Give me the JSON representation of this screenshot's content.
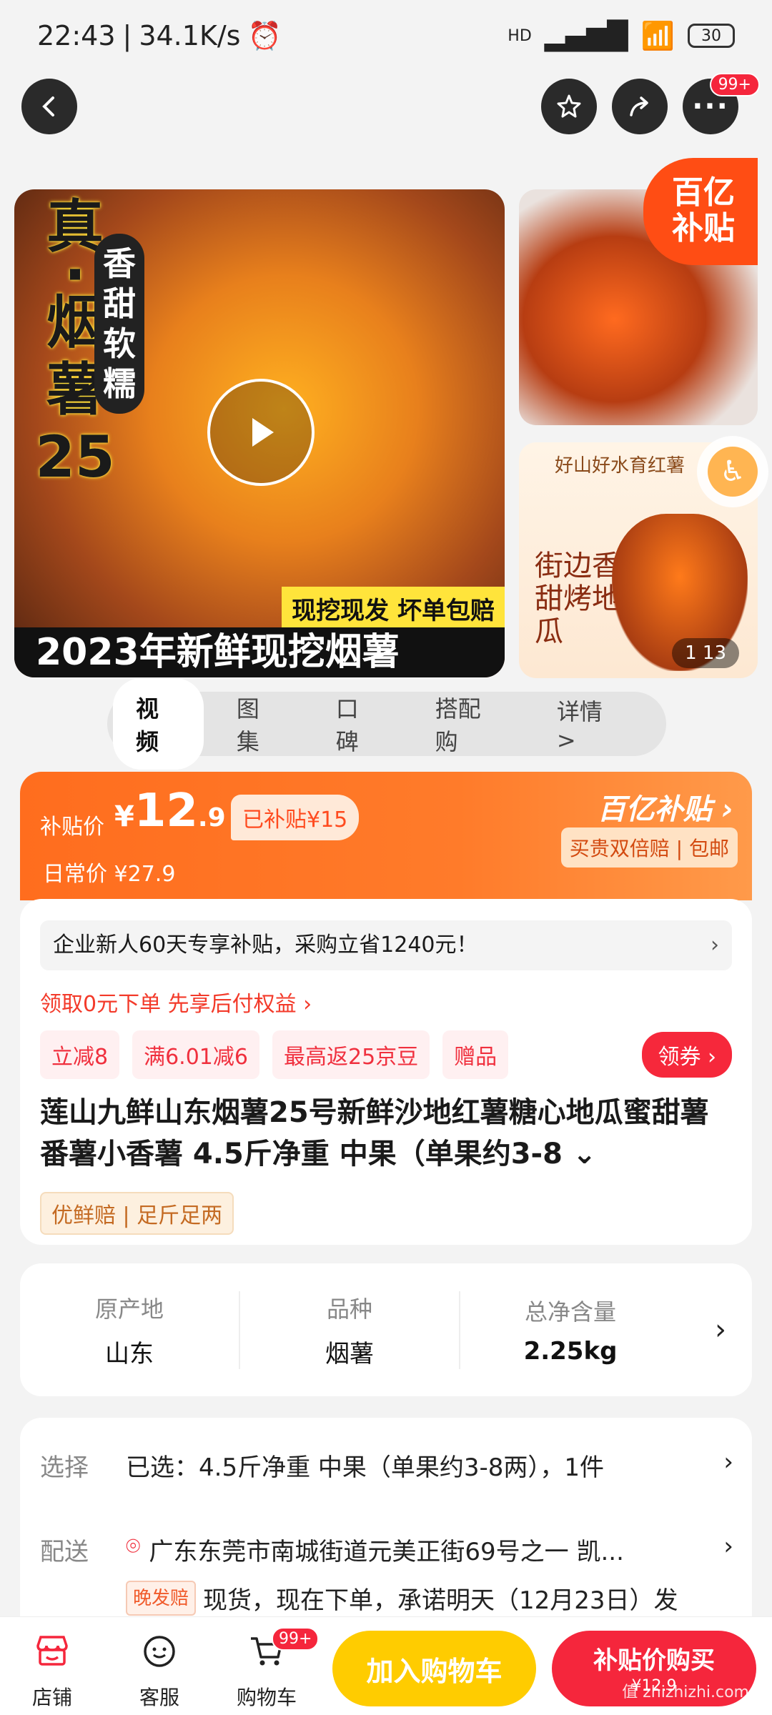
{
  "status": {
    "time": "22:43",
    "speed": "34.1K/s",
    "signal": "HD",
    "battery": "30"
  },
  "header": {
    "more_badge": "99+"
  },
  "gallery": {
    "main_vertical_title": [
      "真",
      "·",
      "烟",
      "薯",
      "25"
    ],
    "main_tag": [
      "香",
      "甜",
      "软",
      "糯"
    ],
    "main_promo": "现挖现发 坏单包赔",
    "main_caption": "2023年新鲜现挖烟薯",
    "side2_title": "好山好水育红薯",
    "side2_slogan": "街边香甜烤地瓜",
    "counter": "1  13",
    "subsidy_badge": "百亿补贴"
  },
  "tabs": [
    "视频",
    "图集",
    "口碑",
    "搭配购",
    "详情 >"
  ],
  "price": {
    "label": "补贴价",
    "currency": "¥",
    "integer": "12",
    "decimal": ".9",
    "subsidized": "已补贴¥15",
    "daily": "日常价 ¥27.9",
    "brand": "百亿补贴 ›",
    "brand_sub": "买贵双倍赔 | 包邮"
  },
  "promo": {
    "notice": "企业新人60天专享补贴，采购立省1240元！",
    "credit": "领取0元下单 先享后付权益 ›",
    "coupons": [
      "立减8",
      "满6.01减6",
      "最高返25京豆",
      "赠品"
    ],
    "get_coupon": "领券 ›"
  },
  "product": {
    "title": "莲山九鲜山东烟薯25号新鲜沙地红薯糖心地瓜蜜甜薯番薯小香薯 4.5斤净重 中果（单果约3-8 ⌄",
    "guarantee": "优鲜赔 | 足斤足两"
  },
  "attrs": [
    {
      "k": "原产地",
      "v": "山东"
    },
    {
      "k": "品种",
      "v": "烟薯"
    },
    {
      "k": "总净含量",
      "v": "2.25kg"
    }
  ],
  "selection": {
    "select_label": "选择",
    "select_value": "已选：4.5斤净重 中果（单果约3-8两），1件",
    "delivery_label": "配送",
    "delivery_value": "广东东莞市南城街道元美正街69号之一 凯...",
    "late_badge": "晚发赔",
    "delivery_note": "现货，现在下单，承诺明天（12月23日）发"
  },
  "bottom": {
    "store": "店铺",
    "service": "客服",
    "cart": "购物车",
    "cart_badge": "99+",
    "add_cart": "加入购物车",
    "buy_now": "补贴价购买",
    "buy_price": "¥12.9",
    "watermark": "值 zhizhizhi.com"
  },
  "colors": {
    "accent": "#f5263c",
    "orange": "#ff6d1e",
    "yellow": "#ffcc00"
  }
}
